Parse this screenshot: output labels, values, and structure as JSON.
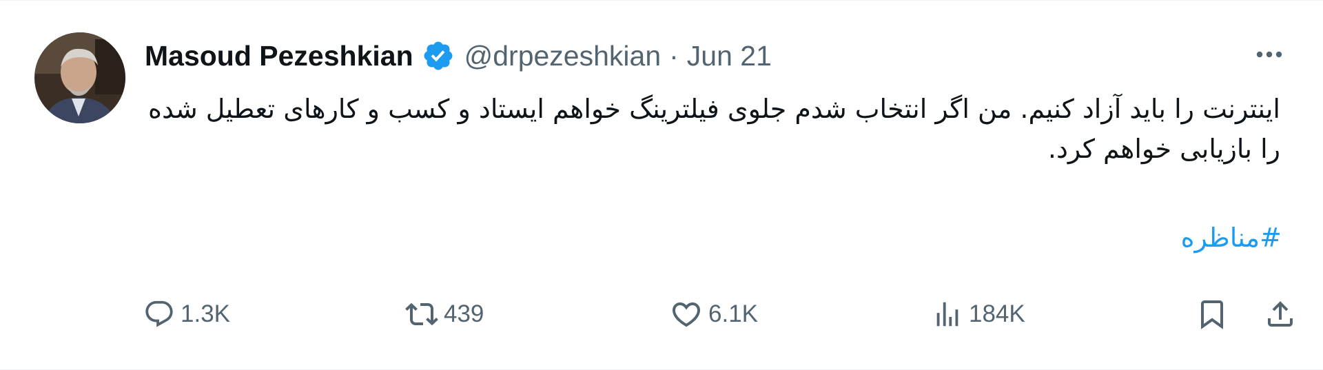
{
  "author": {
    "name": "Masoud Pezeshkian",
    "handle": "@drpezeshkian",
    "separator": "·",
    "date": "Jun 21",
    "verified": true,
    "verified_color": "#1d9bf0"
  },
  "tweet": {
    "text": "اینترنت را باید آزاد کنیم. من اگر انتخاب شدم جلوی فیلترینگ خواهم ایستاد و کسب و کارهای تعطیل شده را بازیابی خواهم کرد.",
    "hashtag": "#مناظره",
    "hashtag_color": "#1d9bf0"
  },
  "actions": {
    "replies": "1.3K",
    "retweets": "439",
    "likes": "6.1K",
    "views": "184K"
  },
  "icons": {
    "reply": "speech-bubble-icon",
    "retweet": "retweet-arrows-icon",
    "like": "heart-icon",
    "views": "bar-chart-icon",
    "bookmark": "bookmark-icon",
    "share": "share-upload-icon",
    "more": "three-dots-icon",
    "verified": "verified-badge-icon"
  },
  "colors": {
    "text_primary": "#0f1419",
    "text_secondary": "#536471",
    "accent": "#1d9bf0"
  }
}
